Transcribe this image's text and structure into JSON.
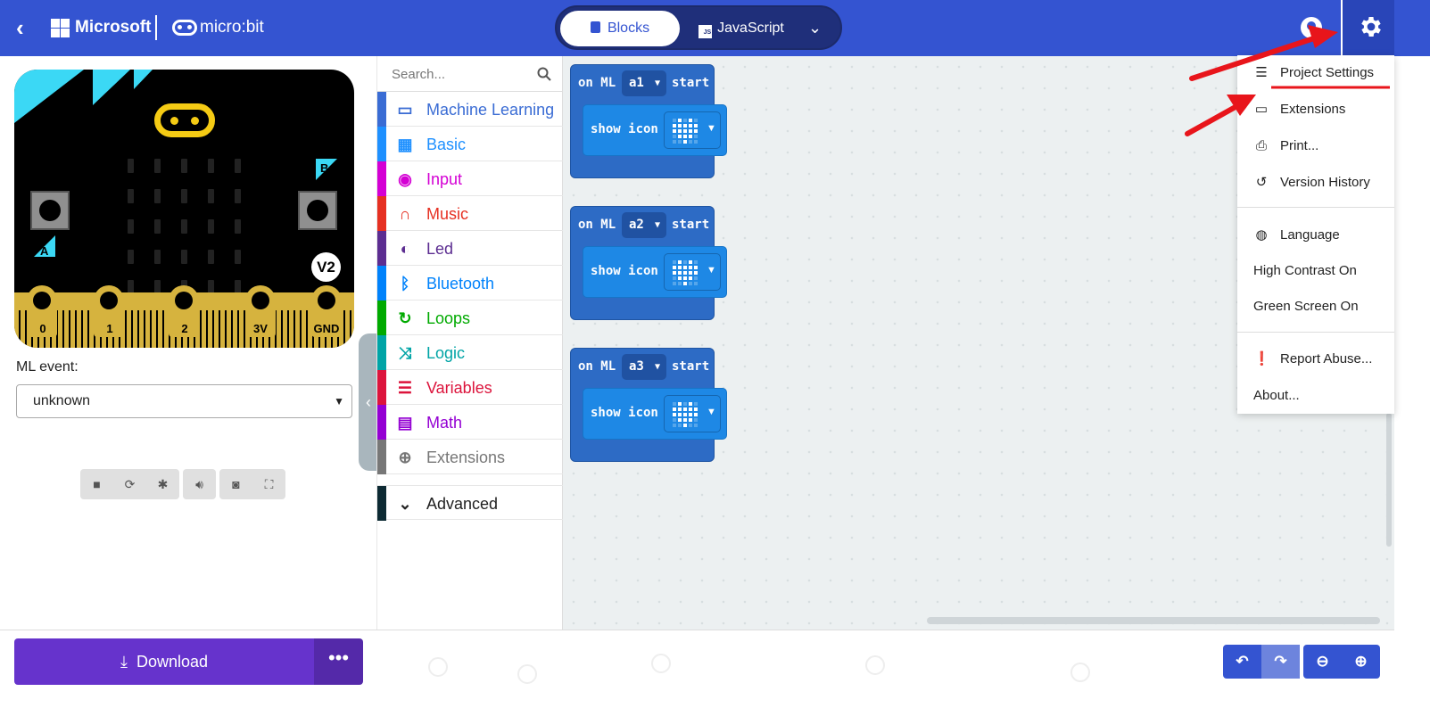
{
  "header": {
    "brand": "Microsoft",
    "product": "micro:bit",
    "editor_tabs": {
      "blocks": "Blocks",
      "javascript": "JavaScript",
      "js_badge": "JS"
    }
  },
  "simulator": {
    "button_a": "A",
    "button_b": "B",
    "version_badge": "V2",
    "pins": [
      "0",
      "1",
      "2",
      "3V",
      "GND"
    ],
    "ml_event_label": "ML event:",
    "ml_event_value": "unknown"
  },
  "toolbox": {
    "search_placeholder": "Search...",
    "categories": [
      {
        "label": "Machine Learning",
        "color": "#3a6cd4",
        "icon": "monitor-icon"
      },
      {
        "label": "Basic",
        "color": "#1e90ff",
        "icon": "grid-icon"
      },
      {
        "label": "Input",
        "color": "#d400d4",
        "icon": "target-icon"
      },
      {
        "label": "Music",
        "color": "#e63022",
        "icon": "headphones-icon"
      },
      {
        "label": "Led",
        "color": "#5c2d91",
        "icon": "toggle-icon"
      },
      {
        "label": "Bluetooth",
        "color": "#0082fb",
        "icon": "bluetooth-icon"
      },
      {
        "label": "Loops",
        "color": "#00aa00",
        "icon": "loop-icon"
      },
      {
        "label": "Logic",
        "color": "#00a4a6",
        "icon": "shuffle-icon"
      },
      {
        "label": "Variables",
        "color": "#dc143c",
        "icon": "list-icon"
      },
      {
        "label": "Math",
        "color": "#9400d3",
        "icon": "calculator-icon"
      },
      {
        "label": "Extensions",
        "color": "#777777",
        "icon": "plus-circle-icon"
      }
    ],
    "advanced": {
      "label": "Advanced",
      "color": "#0d2a33"
    }
  },
  "workspace": {
    "blocks": [
      {
        "event": "on ML",
        "class_value": "a1",
        "start": "start",
        "action": "show icon"
      },
      {
        "event": "on ML",
        "class_value": "a2",
        "start": "start",
        "action": "show icon"
      },
      {
        "event": "on ML",
        "class_value": "a3",
        "start": "start",
        "action": "show icon"
      }
    ]
  },
  "settings_menu": {
    "items": [
      {
        "label": "Project Settings",
        "icon": "sliders-icon"
      },
      {
        "label": "Extensions",
        "icon": "drive-icon"
      },
      {
        "label": "Print...",
        "icon": "printer-icon"
      },
      {
        "label": "Version History",
        "icon": "history-icon"
      },
      {
        "label": "Language",
        "icon": "globe-icon"
      },
      {
        "label": "High Contrast On",
        "icon": ""
      },
      {
        "label": "Green Screen On",
        "icon": ""
      },
      {
        "label": "Report Abuse...",
        "icon": "alert-icon"
      },
      {
        "label": "About...",
        "icon": ""
      }
    ]
  },
  "bottom": {
    "download_label": "Download",
    "more_label": "•••"
  },
  "colors": {
    "header": "#3454d1",
    "download": "#6633cc",
    "annotation": "#e8151b"
  }
}
